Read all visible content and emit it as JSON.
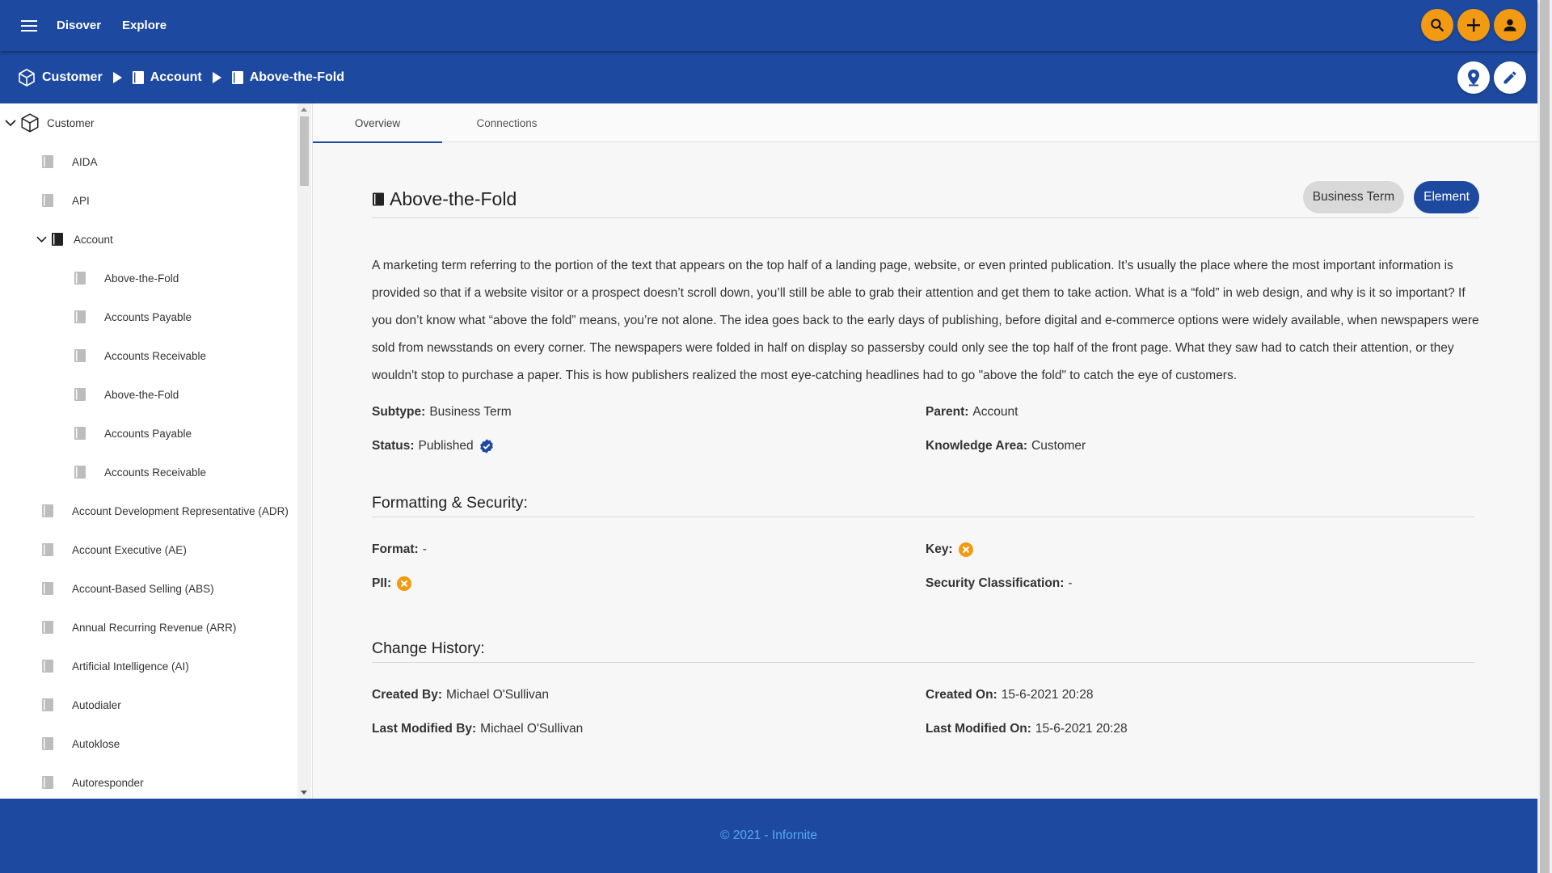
{
  "topbar": {
    "nav": [
      "Disover",
      "Explore"
    ]
  },
  "breadcrumb": [
    "Customer",
    "Account",
    "Above-the-Fold"
  ],
  "sidebar": {
    "root": "Customer",
    "items": [
      {
        "label": "AIDA",
        "depth": 1
      },
      {
        "label": "API",
        "depth": 1
      },
      {
        "label": "Account",
        "depth": 1,
        "expanded": true
      },
      {
        "label": "Above-the-Fold",
        "depth": 2
      },
      {
        "label": "Accounts Payable",
        "depth": 2
      },
      {
        "label": "Accounts Receivable",
        "depth": 2
      },
      {
        "label": "Above-the-Fold",
        "depth": 2
      },
      {
        "label": "Accounts Payable",
        "depth": 2
      },
      {
        "label": "Accounts Receivable",
        "depth": 2
      },
      {
        "label": "Account Development Representative (ADR)",
        "depth": 1
      },
      {
        "label": "Account Executive (AE)",
        "depth": 1
      },
      {
        "label": "Account-Based Selling (ABS)",
        "depth": 1
      },
      {
        "label": "Annual Recurring Revenue (ARR)",
        "depth": 1
      },
      {
        "label": "Artificial Intelligence (AI)",
        "depth": 1
      },
      {
        "label": "Autodialer",
        "depth": 1
      },
      {
        "label": "Autoklose",
        "depth": 1
      },
      {
        "label": "Autoresponder",
        "depth": 1
      }
    ]
  },
  "tabs": [
    "Overview",
    "Connections"
  ],
  "detail": {
    "title": "Above-the-Fold",
    "chips": [
      "Business Term",
      "Element"
    ],
    "description": "A marketing term referring to the portion of the text that appears on the top half of a landing page, website, or even printed publication. It’s usually the place where the most important information is provided so that if a website visitor or a prospect doesn’t scroll down, you’ll still be able to grab their attention and get them to take action. What is a “fold” in web design, and why is it so important? If you don’t know what “above the fold” means, you’re not alone. The idea goes back to the early days of publishing, before digital and e-commerce options were widely available, when newspapers were sold from newsstands on every corner. The newspapers were folded in half on display so passersby could only see the top half of the front page. What they saw had to catch their attention, or they wouldn't stop to purchase a paper. This is how publishers realized the most eye-catching headlines had to go \"above the fold\" to catch the eye of customers.",
    "fields": {
      "subtype_label": "Subtype:",
      "subtype": "Business Term",
      "parent_label": "Parent:",
      "parent": "Account",
      "status_label": "Status:",
      "status": "Published",
      "ka_label": "Knowledge Area:",
      "ka": "Customer"
    },
    "formatting": {
      "heading": "Formatting & Security:",
      "format_label": "Format:",
      "format": "-",
      "key_label": "Key:",
      "pii_label": "PII:",
      "sec_label": "Security Classification:",
      "sec": "-"
    },
    "history": {
      "heading": "Change History:",
      "created_by_label": "Created By:",
      "created_by": "Michael O'Sullivan",
      "created_on_label": "Created On:",
      "created_on": "15-6-2021 20:28",
      "modified_by_label": "Last Modified By:",
      "modified_by": "Michael O'Sullivan",
      "modified_on_label": "Last Modified On:",
      "modified_on": "15-6-2021 20:28"
    }
  },
  "footer": "© 2021 - Infornite",
  "colors": {
    "primary": "#1d4aa0",
    "accent": "#f29a12",
    "footer_text": "#59a7ef"
  },
  "icons": {
    "menu": "hamburger-icon",
    "search": "search-icon",
    "add": "plus-icon",
    "account": "person-icon",
    "location": "location-pin-icon",
    "edit": "pencil-icon",
    "root": "cube-icon",
    "term": "book-icon",
    "published": "check-badge-icon",
    "no": "cancel-circle-icon"
  }
}
